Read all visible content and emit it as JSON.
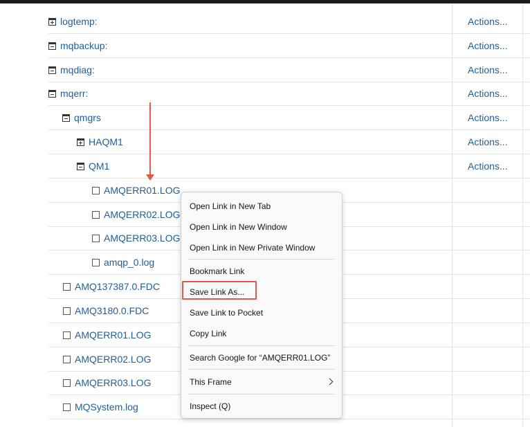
{
  "rows": [
    {
      "name": "logtemp:",
      "icon": "plus",
      "actions": "Actions..."
    },
    {
      "name": "mqbackup:",
      "icon": "minus",
      "actions": "Actions..."
    },
    {
      "name": "mqdiag:",
      "icon": "minus",
      "actions": "Actions..."
    },
    {
      "name": "mqerr:",
      "icon": "minus",
      "actions": "Actions..."
    },
    {
      "name": "qmgrs",
      "icon": "minus",
      "actions": "Actions..."
    },
    {
      "name": "HAQM1",
      "icon": "plus",
      "actions": "Actions..."
    },
    {
      "name": "QM1",
      "icon": "minus",
      "actions": "Actions..."
    },
    {
      "name": "AMQERR01.LOG",
      "icon": "file"
    },
    {
      "name": "AMQERR02.LOG",
      "icon": "file"
    },
    {
      "name": "AMQERR03.LOG",
      "icon": "file"
    },
    {
      "name": "amqp_0.log",
      "icon": "file"
    },
    {
      "name": "AMQ137387.0.FDC",
      "icon": "file"
    },
    {
      "name": "AMQ3180.0.FDC",
      "icon": "file"
    },
    {
      "name": "AMQERR01.LOG",
      "icon": "file"
    },
    {
      "name": "AMQERR02.LOG",
      "icon": "file"
    },
    {
      "name": "AMQERR03.LOG",
      "icon": "file"
    },
    {
      "name": "MQSystem.log",
      "icon": "file"
    }
  ],
  "context_menu": {
    "items": [
      "Open Link in New Tab",
      "Open Link in New Window",
      "Open Link in New Private Window",
      "Bookmark Link",
      "Save Link As...",
      "Save Link to Pocket",
      "Copy Link",
      "Search Google for “AMQERR01.LOG”",
      "This Frame",
      "Inspect (Q)"
    ],
    "highlighted": "Save Link As..."
  },
  "colors": {
    "link": "#1f5e9a",
    "annotation": "#e05a4a"
  }
}
